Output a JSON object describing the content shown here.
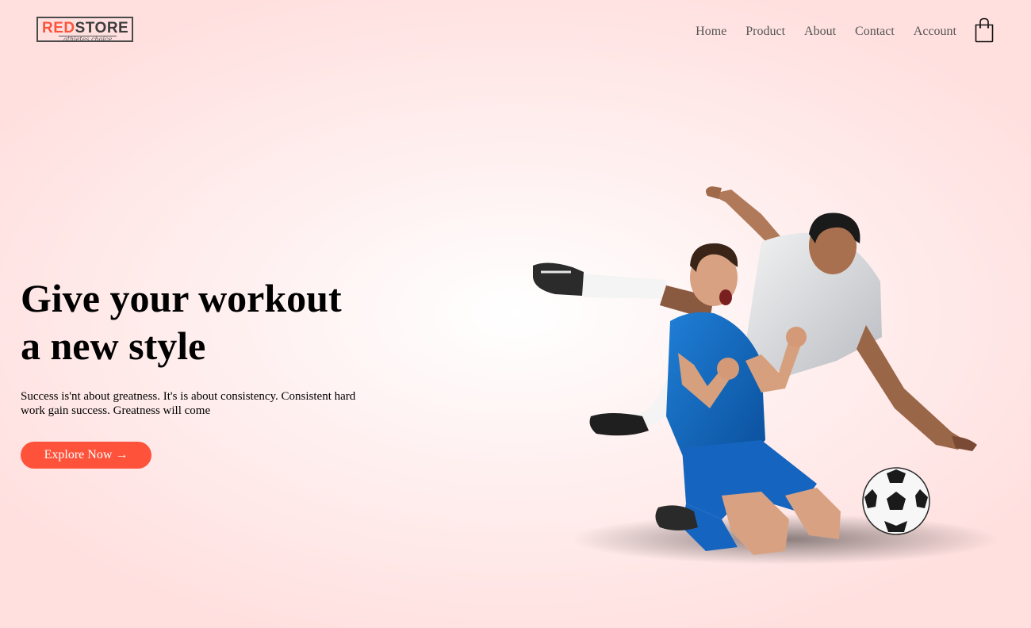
{
  "brand": {
    "name_red": "RED",
    "name_dark": "STORE",
    "tagline": "athletes choice"
  },
  "nav": {
    "items": [
      "Home",
      "Product",
      "About",
      "Contact",
      "Account"
    ],
    "cart_icon": "shopping-bag-icon"
  },
  "hero": {
    "title_line1": "Give your workout",
    "title_line2": "a new style",
    "subtitle": "Success is'nt about greatness. It's is about consistency. Consistent hard work gain success. Greatness will come",
    "cta_label": "Explore Now →"
  },
  "colors": {
    "accent": "#ff523b",
    "background": "#ffe0df",
    "text": "#000000",
    "nav_text": "#555555"
  }
}
